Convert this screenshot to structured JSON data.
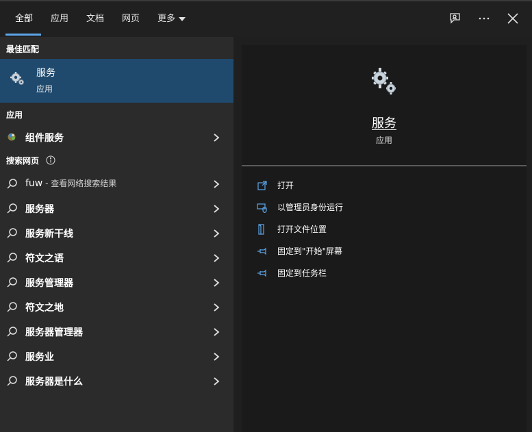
{
  "tabs": [
    {
      "label": "全部",
      "active": true
    },
    {
      "label": "应用"
    },
    {
      "label": "文档"
    },
    {
      "label": "网页"
    },
    {
      "label": "更多"
    }
  ],
  "top_icons": [
    "feedback-icon",
    "more-icon",
    "close-icon"
  ],
  "left": {
    "best_match_heading": "最佳匹配",
    "best_match": {
      "title": "服务",
      "subtitle": "应用",
      "icon": "gears-icon"
    },
    "apps_heading": "应用",
    "apps": [
      {
        "label": "组件服务",
        "icon": "component-services-icon"
      }
    ],
    "web_heading": "搜索网页",
    "web_results": [
      {
        "label": "fuw",
        "suffix": " - 查看网络搜索结果"
      },
      {
        "label": "服务器"
      },
      {
        "label": "服务新干线"
      },
      {
        "label": "符文之语"
      },
      {
        "label": "服务管理器"
      },
      {
        "label": "符文之地"
      },
      {
        "label": "服务器管理器"
      },
      {
        "label": "服务业"
      },
      {
        "label": "服务器是什么"
      }
    ]
  },
  "preview": {
    "title": "服务",
    "subtitle": "应用",
    "actions": [
      {
        "label": "打开",
        "icon": "open-icon"
      },
      {
        "label": "以管理员身份运行",
        "icon": "shield-icon"
      },
      {
        "label": "打开文件位置",
        "icon": "file-location-icon"
      },
      {
        "label": "固定到\"开始\"屏幕",
        "icon": "pin-icon"
      },
      {
        "label": "固定到任务栏",
        "icon": "pin-icon"
      }
    ]
  },
  "colors": {
    "accent": "#5ea5e8",
    "selection": "#1f4a6e"
  }
}
